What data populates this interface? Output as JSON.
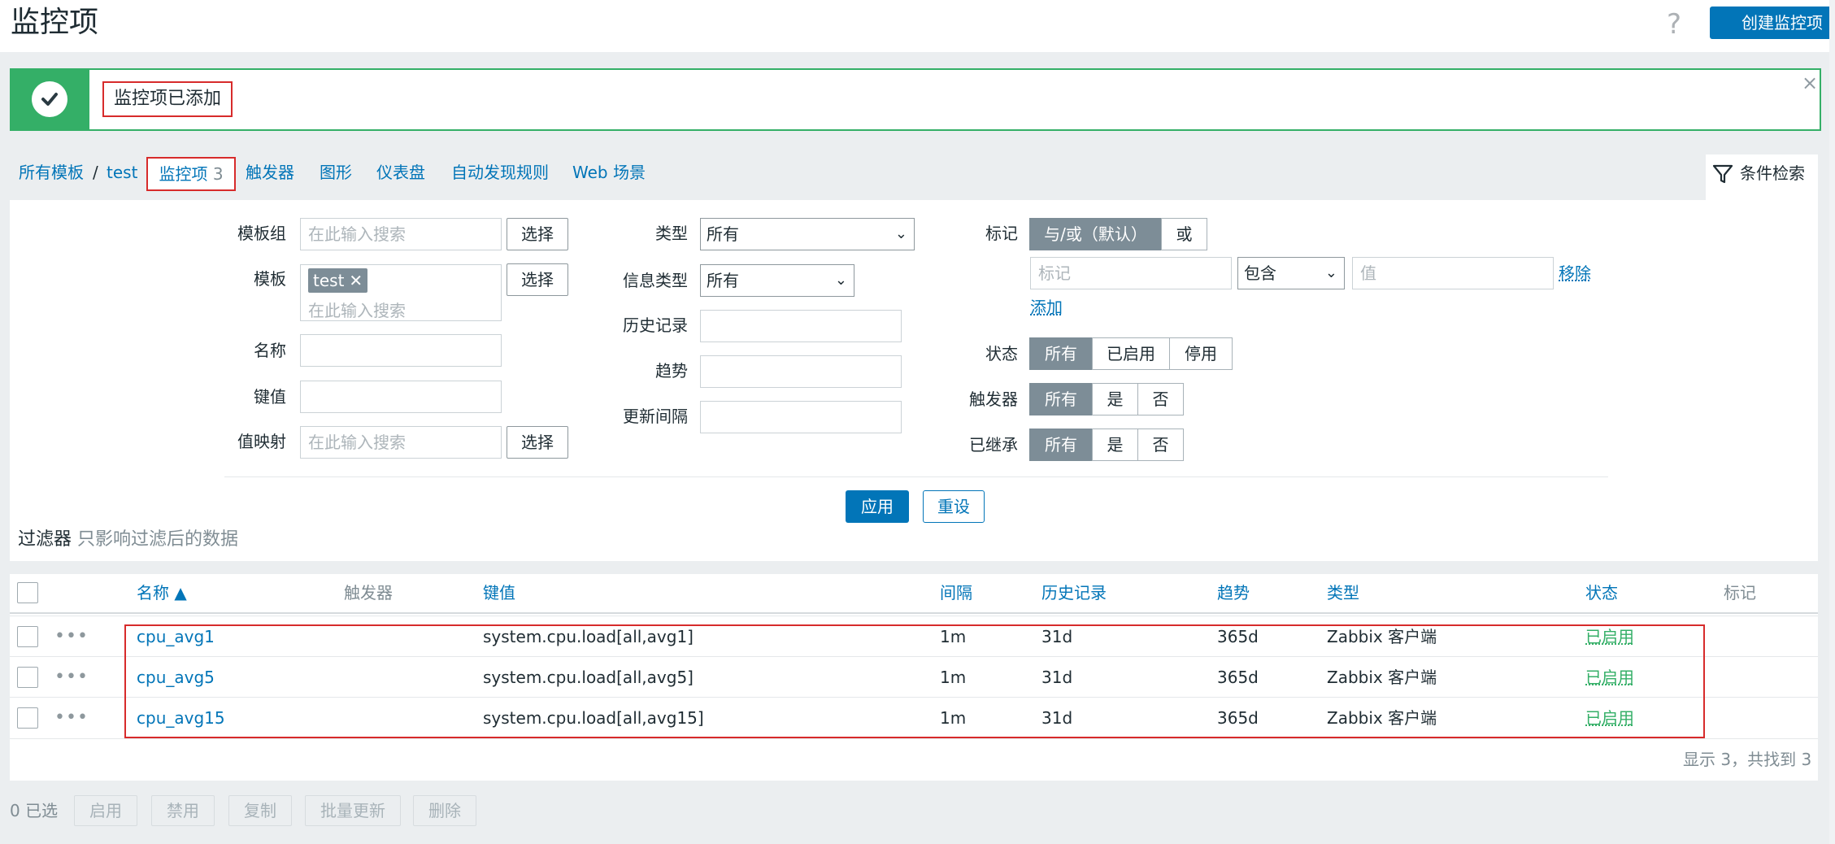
{
  "header": {
    "title": "监控项",
    "help": "?",
    "create_label": "创建监控项"
  },
  "message": {
    "text": "监控项已添加",
    "close": "×"
  },
  "breadcrumb": {
    "all_templates": "所有模板",
    "separator": "/",
    "template": "test",
    "items_label": "监控项",
    "items_count": "3",
    "tabs": [
      "触发器",
      "图形",
      "仪表盘",
      "自动发现规则",
      "Web 场景"
    ]
  },
  "filter_tab": {
    "label": "条件检索"
  },
  "filter": {
    "template_group": {
      "label": "模板组",
      "placeholder": "在此输入搜索",
      "select": "选择"
    },
    "template": {
      "label": "模板",
      "chip": "test",
      "chip_remove": "✕",
      "placeholder": "在此输入搜索",
      "select": "选择"
    },
    "name": {
      "label": "名称"
    },
    "key": {
      "label": "键值"
    },
    "valuemap": {
      "label": "值映射",
      "placeholder": "在此输入搜索",
      "select": "选择"
    },
    "type": {
      "label": "类型",
      "value": "所有"
    },
    "info_type": {
      "label": "信息类型",
      "value": "所有"
    },
    "history": {
      "label": "历史记录"
    },
    "trends": {
      "label": "趋势"
    },
    "interval": {
      "label": "更新间隔"
    },
    "tags": {
      "label": "标记",
      "and_or": "与/或（默认）",
      "or": "或",
      "tag_placeholder": "标记",
      "op": "包含",
      "value_placeholder": "值",
      "remove": "移除",
      "add": "添加"
    },
    "status": {
      "label": "状态",
      "options": [
        "所有",
        "已启用",
        "停用"
      ]
    },
    "triggers": {
      "label": "触发器",
      "options": [
        "所有",
        "是",
        "否"
      ]
    },
    "inherited": {
      "label": "已继承",
      "options": [
        "所有",
        "是",
        "否"
      ]
    },
    "apply": "应用",
    "reset": "重设",
    "note_title": "过滤器",
    "note_text": "只影响过滤后的数据"
  },
  "table": {
    "columns": [
      "名称 ▲",
      "触发器",
      "键值",
      "间隔",
      "历史记录",
      "趋势",
      "类型",
      "状态",
      "标记"
    ],
    "rows": [
      {
        "name": "cpu_avg1",
        "triggers": "",
        "key": "system.cpu.load[all,avg1]",
        "interval": "1m",
        "history": "31d",
        "trends": "365d",
        "type": "Zabbix 客户端",
        "status": "已启用"
      },
      {
        "name": "cpu_avg5",
        "triggers": "",
        "key": "system.cpu.load[all,avg5]",
        "interval": "1m",
        "history": "31d",
        "trends": "365d",
        "type": "Zabbix 客户端",
        "status": "已启用"
      },
      {
        "name": "cpu_avg15",
        "triggers": "",
        "key": "system.cpu.load[all,avg15]",
        "interval": "1m",
        "history": "31d",
        "trends": "365d",
        "type": "Zabbix 客户端",
        "status": "已启用"
      }
    ],
    "row_menu": "•••",
    "footer": "显示 3，共找到 3"
  },
  "actions": {
    "selected": "0 已选",
    "buttons": [
      "启用",
      "禁用",
      "复制",
      "批量更新",
      "删除"
    ]
  },
  "colors": {
    "accent": "#0275b8",
    "success": "#34af67",
    "highlight_box": "#d72b2b"
  }
}
